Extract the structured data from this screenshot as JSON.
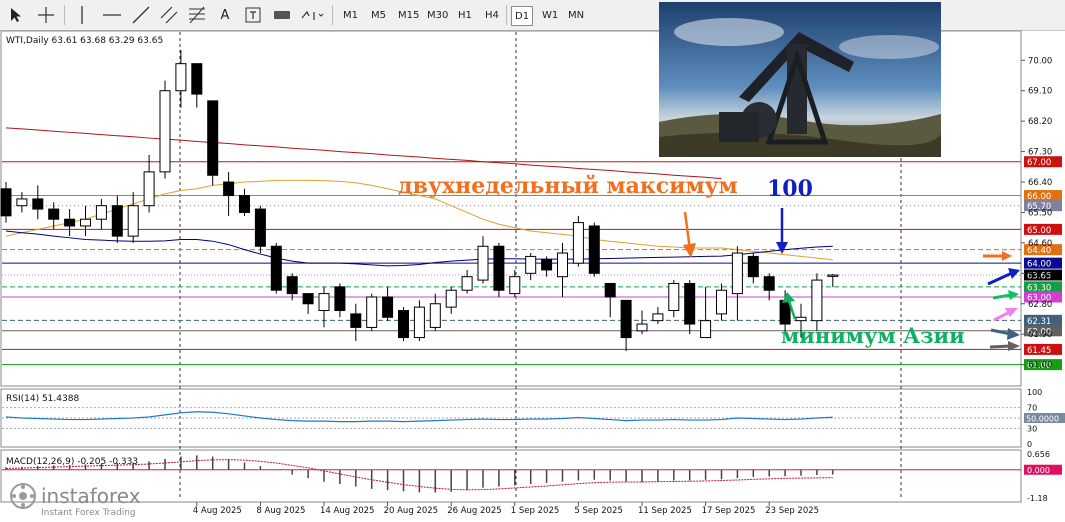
{
  "toolbar": {
    "timeframes": [
      "M1",
      "M5",
      "M15",
      "M30",
      "H1",
      "H4",
      "D1",
      "W1",
      "MN"
    ],
    "active_timeframe": "D1",
    "tool_icons": [
      "cursor-icon",
      "crosshair-icon",
      "vertical-line-icon",
      "horizontal-line-icon",
      "trendline-icon",
      "equidistant-channel-icon",
      "fibonacci-icon",
      "text-icon",
      "text-label-icon",
      "arrows-icon"
    ]
  },
  "chart_header": "WTI,Daily  63.61 63.68 63.29 63.65",
  "rsi_header": "RSI(14) 51.4388",
  "macd_header": "MACD(12,26,9) -0.205 -0.333",
  "annotations": {
    "two_week_max": "двухнедельный максимум",
    "ma_label": "100",
    "asia_min": "минимум Азии"
  },
  "brand": {
    "name": "instaforex",
    "tagline": "Instant Forex Trading"
  },
  "colors": {
    "up_candle": "#ffffff",
    "down_candle": "#000000",
    "ma100": "#000080",
    "ma_orange": "#e0a030",
    "ma_red": "#b01515",
    "annot_orange": "#f07020",
    "annot_green": "#10b060",
    "annot_blue": "#1020c0",
    "rsi_line": "#1e78c8",
    "macd_line": "#e01060"
  },
  "chart_data": {
    "type": "candlestick",
    "symbol": "WTI",
    "timeframe": "Daily",
    "ohlc_last": {
      "open": 63.61,
      "high": 63.68,
      "low": 63.29,
      "close": 63.65
    },
    "current_price": 63.65,
    "ylim": [
      60.9,
      70.6
    ],
    "y_ticks": [
      70.0,
      69.1,
      68.2,
      67.3,
      66.4,
      65.5,
      64.6,
      63.7,
      62.8,
      61.9,
      61.0
    ],
    "x_tick_labels": [
      "4 Aug 2025",
      "8 Aug 2025",
      "14 Aug 2025",
      "20 Aug 2025",
      "26 Aug 2025",
      "1 Sep 2025",
      "5 Sep 2025",
      "11 Sep 2025",
      "17 Sep 2025",
      "23 Sep 2025"
    ],
    "x_tick_indices": [
      12,
      16,
      20,
      24,
      28,
      32,
      36,
      40,
      44,
      48
    ],
    "candles": [
      [
        66.2,
        65.4,
        66.4,
        65.2
      ],
      [
        65.7,
        65.9,
        66.1,
        65.5
      ],
      [
        65.9,
        65.6,
        66.3,
        65.3
      ],
      [
        65.6,
        65.3,
        65.8,
        65.0
      ],
      [
        65.3,
        65.1,
        65.6,
        64.8
      ],
      [
        65.1,
        65.3,
        65.7,
        64.8
      ],
      [
        65.3,
        65.7,
        65.9,
        65.0
      ],
      [
        65.7,
        64.8,
        66.0,
        64.6
      ],
      [
        64.8,
        65.7,
        66.1,
        64.6
      ],
      [
        65.7,
        66.7,
        67.2,
        65.5
      ],
      [
        66.7,
        69.1,
        69.4,
        66.5
      ],
      [
        69.1,
        69.9,
        70.3,
        68.6
      ],
      [
        69.9,
        69.0,
        69.9,
        68.6
      ],
      [
        68.8,
        66.6,
        68.8,
        66.3
      ],
      [
        66.4,
        66.0,
        66.7,
        65.4
      ],
      [
        66.0,
        65.5,
        66.2,
        65.4
      ],
      [
        65.6,
        64.5,
        65.7,
        64.3
      ],
      [
        64.5,
        63.2,
        64.6,
        63.1
      ],
      [
        63.6,
        63.1,
        63.7,
        62.9
      ],
      [
        63.1,
        62.8,
        63.1,
        62.5
      ],
      [
        62.6,
        63.1,
        63.3,
        62.1
      ],
      [
        63.3,
        62.6,
        63.4,
        62.4
      ],
      [
        62.5,
        62.1,
        62.8,
        61.7
      ],
      [
        62.1,
        63.0,
        63.1,
        62.0
      ],
      [
        63.0,
        62.4,
        63.3,
        62.3
      ],
      [
        62.6,
        61.8,
        62.7,
        61.7
      ],
      [
        61.8,
        62.7,
        62.9,
        61.7
      ],
      [
        62.1,
        62.8,
        63.1,
        62.0
      ],
      [
        62.7,
        63.2,
        63.3,
        62.5
      ],
      [
        63.2,
        63.6,
        63.8,
        63.1
      ],
      [
        63.5,
        64.5,
        64.8,
        63.4
      ],
      [
        64.5,
        63.2,
        64.6,
        63.0
      ],
      [
        63.1,
        63.6,
        63.8,
        63.0
      ],
      [
        63.7,
        64.2,
        64.3,
        63.5
      ],
      [
        64.1,
        63.8,
        64.2,
        63.6
      ],
      [
        63.6,
        64.3,
        64.6,
        63.0
      ],
      [
        64.0,
        65.2,
        65.4,
        63.9
      ],
      [
        65.1,
        63.7,
        65.2,
        63.6
      ],
      [
        63.4,
        63.0,
        63.4,
        62.4
      ],
      [
        62.9,
        61.8,
        62.9,
        61.4
      ],
      [
        62.0,
        62.2,
        62.6,
        61.9
      ],
      [
        62.3,
        62.5,
        62.7,
        62.2
      ],
      [
        62.6,
        63.4,
        63.5,
        62.4
      ],
      [
        63.4,
        62.2,
        63.5,
        61.9
      ],
      [
        61.8,
        62.3,
        63.3,
        61.9
      ],
      [
        62.5,
        63.2,
        63.4,
        62.3
      ],
      [
        63.1,
        64.3,
        64.5,
        62.3
      ],
      [
        64.2,
        63.6,
        64.3,
        63.4
      ],
      [
        63.6,
        63.2,
        63.7,
        62.9
      ],
      [
        62.9,
        62.2,
        63.2,
        61.9
      ],
      [
        62.3,
        62.4,
        62.8,
        61.8
      ],
      [
        62.3,
        63.5,
        63.7,
        62.0
      ],
      [
        63.61,
        63.65,
        63.68,
        63.29
      ]
    ],
    "ma100": [
      64.95,
      64.9,
      64.86,
      64.8,
      64.75,
      64.7,
      64.68,
      64.66,
      64.65,
      64.65,
      64.66,
      64.7,
      64.7,
      64.65,
      64.55,
      64.4,
      64.27,
      64.15,
      64.06,
      64.0,
      64.0,
      64.0,
      63.98,
      63.95,
      63.92,
      63.93,
      63.96,
      64.02,
      64.06,
      64.09,
      64.12,
      64.13,
      64.13,
      64.12,
      64.12,
      64.12,
      64.12,
      64.13,
      64.14,
      64.15,
      64.16,
      64.17,
      64.18,
      64.19,
      64.2,
      64.21,
      64.25,
      64.3,
      64.35,
      64.4,
      64.44,
      64.48,
      64.5
    ],
    "ma_orange": [
      64.8,
      64.9,
      65.0,
      65.1,
      65.2,
      65.3,
      65.45,
      65.6,
      65.75,
      65.9,
      66.05,
      66.15,
      66.2,
      66.3,
      66.35,
      66.4,
      66.42,
      66.45,
      66.45,
      66.45,
      66.44,
      66.42,
      66.38,
      66.3,
      66.2,
      66.1,
      66.0,
      65.9,
      65.7,
      65.5,
      65.3,
      65.15,
      65.05,
      64.95,
      64.9,
      64.85,
      64.8,
      64.7,
      64.65,
      64.6,
      64.55,
      64.5,
      64.48,
      64.45,
      64.45,
      64.45,
      64.4,
      64.35,
      64.3,
      64.25,
      64.2,
      64.15,
      64.1
    ],
    "ma_red": [
      68.0,
      67.97,
      67.94,
      67.9,
      67.87,
      67.84,
      67.8,
      67.77,
      67.74,
      67.7,
      67.67,
      67.64,
      67.6,
      67.57,
      67.54,
      67.5,
      67.47,
      67.44,
      67.4,
      67.37,
      67.34,
      67.3,
      67.27,
      67.24,
      67.2,
      67.17,
      67.14,
      67.1,
      67.07,
      67.04,
      67.0,
      66.97,
      66.94,
      66.9,
      66.87,
      66.84,
      66.8,
      66.77,
      66.74,
      66.7,
      66.67,
      66.64,
      66.6,
      66.57,
      66.54,
      66.5
    ],
    "levels": [
      {
        "price": 67.0,
        "label": "67.00",
        "color": "#cc1010",
        "style": "solid"
      },
      {
        "price": 66.0,
        "label": "66.00",
        "color": "#e07010",
        "style": "solid"
      },
      {
        "price": 65.7,
        "label": "65.70",
        "color": "#8080a0",
        "style": "dotted"
      },
      {
        "price": 65.0,
        "label": "65.00",
        "color": "#cc1010",
        "style": "solid"
      },
      {
        "price": 64.4,
        "label": "64.40",
        "color": "#e07010",
        "style": "dashed"
      },
      {
        "price": 64.0,
        "label": "64.00",
        "color": "#0a0a90",
        "style": "solid"
      },
      {
        "price": 63.3,
        "label": "63.30",
        "color": "#10a040",
        "style": "dashed"
      },
      {
        "price": 63.0,
        "label": "63.00",
        "color": "#d040d0",
        "style": "solid"
      },
      {
        "price": 62.31,
        "label": "62.31",
        "color": "#406080",
        "style": "dashed"
      },
      {
        "price": 62.0,
        "label": "62.00",
        "color": "#606060",
        "style": "solid"
      },
      {
        "price": 61.45,
        "label": "61.45",
        "color": "#cc1010",
        "style": "solid"
      },
      {
        "price": 61.0,
        "label": "61.00",
        "color": "#10a010",
        "style": "solid"
      }
    ],
    "rsi": {
      "value": 51.4388,
      "levels": [
        70,
        50,
        30
      ],
      "tick_labels": [
        "100",
        "70",
        "50.0000",
        "30",
        "0"
      ],
      "values": [
        52,
        50,
        49,
        48,
        47,
        47,
        48,
        49,
        50,
        52,
        56,
        60,
        62,
        61,
        58,
        54,
        50,
        47,
        45,
        44,
        44,
        43,
        43,
        44,
        44,
        43,
        44,
        45,
        46,
        47,
        48,
        47,
        47,
        48,
        48,
        49,
        51,
        49,
        47,
        45,
        46,
        46,
        47,
        46,
        46,
        47,
        50,
        49,
        48,
        47,
        48,
        50,
        51.4
      ]
    },
    "macd": {
      "value": -0.205,
      "signal": -0.333,
      "tick_labels": [
        "0.656",
        "0.000",
        "-1.18"
      ],
      "histogram": [
        0.1,
        0.12,
        0.15,
        0.18,
        0.2,
        0.22,
        0.25,
        0.28,
        0.3,
        0.35,
        0.45,
        0.55,
        0.6,
        0.55,
        0.45,
        0.3,
        0.15,
        0.0,
        -0.2,
        -0.35,
        -0.5,
        -0.6,
        -0.7,
        -0.8,
        -0.85,
        -0.9,
        -0.95,
        -0.95,
        -0.92,
        -0.85,
        -0.75,
        -0.7,
        -0.65,
        -0.6,
        -0.55,
        -0.5,
        -0.45,
        -0.42,
        -0.45,
        -0.5,
        -0.52,
        -0.5,
        -0.45,
        -0.45,
        -0.42,
        -0.4,
        -0.35,
        -0.3,
        -0.28,
        -0.27,
        -0.25,
        -0.22,
        -0.2
      ],
      "signal_line": [
        0.05,
        0.07,
        0.09,
        0.11,
        0.13,
        0.15,
        0.17,
        0.19,
        0.21,
        0.24,
        0.28,
        0.33,
        0.38,
        0.41,
        0.42,
        0.4,
        0.35,
        0.28,
        0.18,
        0.08,
        -0.05,
        -0.18,
        -0.3,
        -0.42,
        -0.52,
        -0.62,
        -0.7,
        -0.77,
        -0.82,
        -0.84,
        -0.83,
        -0.8,
        -0.76,
        -0.72,
        -0.68,
        -0.63,
        -0.58,
        -0.54,
        -0.52,
        -0.51,
        -0.51,
        -0.5,
        -0.49,
        -0.48,
        -0.47,
        -0.45,
        -0.43,
        -0.4,
        -0.38,
        -0.36,
        -0.35,
        -0.34,
        -0.333
      ]
    }
  }
}
